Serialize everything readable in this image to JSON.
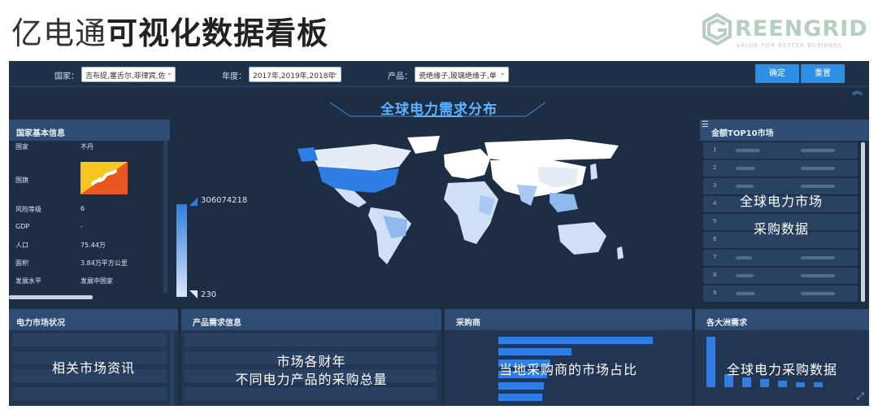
{
  "slide": {
    "title_light": "亿电通",
    "title_bold": "可视化数据看板",
    "logo_text": "REENGRID",
    "logo_sub": "VALUE FOR BETTER BUSINESS",
    "logo_icon": "green-g-icon"
  },
  "filters": {
    "country_label": "国家：",
    "country_value": "吉布提,塞舌尔,菲律宾,佐",
    "year_label": "年度：",
    "year_value": "2017年,2019年,2018年",
    "product_label": "产品：",
    "product_value": "瓷绝缘子,玻璃绝缘子,单",
    "confirm_label": "确定",
    "reset_label": "重置"
  },
  "map": {
    "title": "全球电力需求分布",
    "legend_max": "306074218",
    "legend_min": "230"
  },
  "country_info": {
    "title": "国家基本信息",
    "rows": [
      {
        "key": "国家",
        "value": "不丹"
      },
      {
        "key": "国旗",
        "value": ""
      },
      {
        "key": "风险等级",
        "value": "6"
      },
      {
        "key": "GDP",
        "value": "-"
      },
      {
        "key": "人口",
        "value": "75.44万"
      },
      {
        "key": "面积",
        "value": "3.84万平方公里"
      },
      {
        "key": "发展水平",
        "value": "发展中国家"
      }
    ]
  },
  "top10": {
    "title": "金额TOP10市场",
    "overlay_line1": "全球电力市场",
    "overlay_line2": "采购数据",
    "indices": [
      "1",
      "2",
      "3",
      "4",
      "5",
      "6",
      "7",
      "8",
      "9"
    ]
  },
  "panels": {
    "market": {
      "title": "电力市场状况",
      "overlay": "相关市场资讯"
    },
    "product": {
      "title": "产品需求信息",
      "overlay_line1": "市场各财年",
      "overlay_line2": "不同电力产品的采购总量"
    },
    "buyers": {
      "title": "采购商",
      "overlay": "当地采购商的市场占比"
    },
    "continents": {
      "title": "各大洲需求",
      "overlay": "全球电力采购数据"
    }
  },
  "colors": {
    "accent": "#5fb2ff",
    "button": "#2e8fe6",
    "bg": "#1c2d44"
  }
}
